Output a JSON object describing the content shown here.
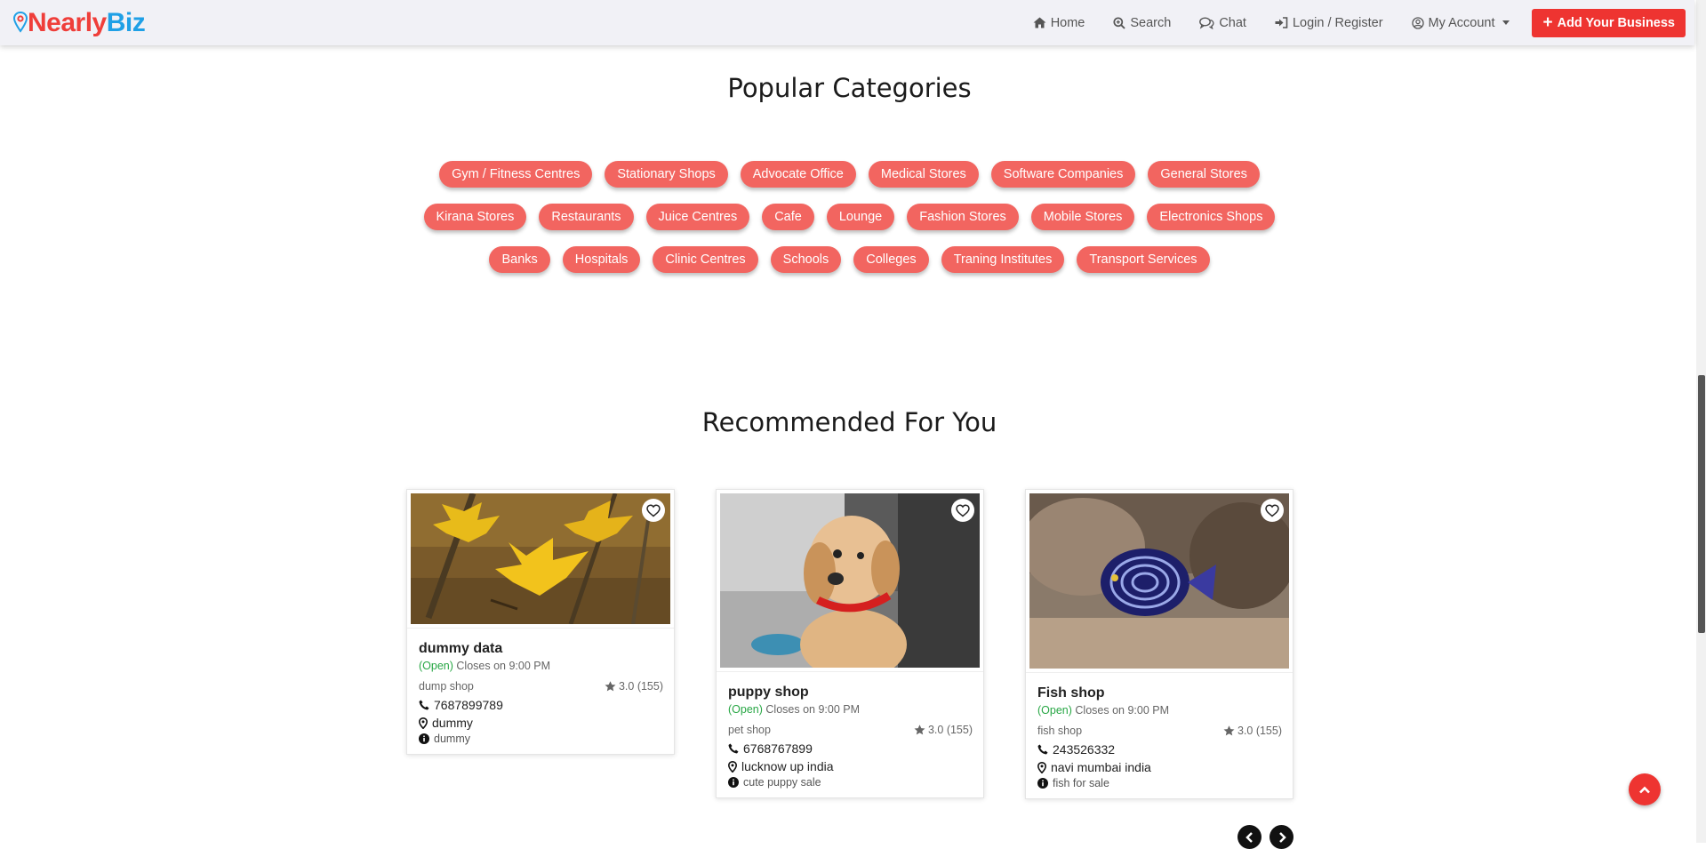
{
  "brand": {
    "part1": "Nearly",
    "part2": "Biz"
  },
  "nav": {
    "home": "Home",
    "search": "Search",
    "chat": "Chat",
    "login": "Login / Register",
    "account": "My Account",
    "add_business": "Add Your Business"
  },
  "categories": {
    "title": "Popular Categories",
    "row1": [
      "Gym / Fitness Centres",
      "Stationary Shops",
      "Advocate Office",
      "Medical Stores",
      "Software Companies",
      "General Stores"
    ],
    "row2": [
      "Kirana Stores",
      "Restaurants",
      "Juice Centres",
      "Cafe",
      "Lounge",
      "Fashion Stores",
      "Mobile Stores",
      "Electronics Shops"
    ],
    "row3": [
      "Banks",
      "Hospitals",
      "Clinic Centres",
      "Schools",
      "Colleges",
      "Traning Institutes",
      "Transport Services"
    ]
  },
  "recommended": {
    "title": "Recommended For You",
    "cards": [
      {
        "name": "dummy data",
        "open": "(Open)",
        "closes": "Closes on 9:00 PM",
        "category": "dump shop",
        "rating": "3.0 (155)",
        "phone": "7687899789",
        "location": "dummy",
        "info": "dummy",
        "image": "yellow-leaves-photo"
      },
      {
        "name": "puppy shop",
        "open": "(Open)",
        "closes": "Closes on 9:00 PM",
        "category": "pet shop",
        "rating": "3.0 (155)",
        "phone": "6768767899",
        "location": "lucknow up india",
        "info": "cute puppy sale",
        "image": "puppy-photo"
      },
      {
        "name": "Fish shop",
        "open": "(Open)",
        "closes": "Closes on 9:00 PM",
        "category": "fish shop",
        "rating": "3.0 (155)",
        "phone": "243526332",
        "location": "navi mumbai india",
        "info": "fish for sale",
        "image": "angelfish-photo"
      }
    ]
  },
  "colors": {
    "accent": "#ee3431",
    "category_pill": "#f26560",
    "brand_red": "#ef3e3a",
    "brand_blue": "#1fa0e6",
    "open_green": "#28a745"
  }
}
